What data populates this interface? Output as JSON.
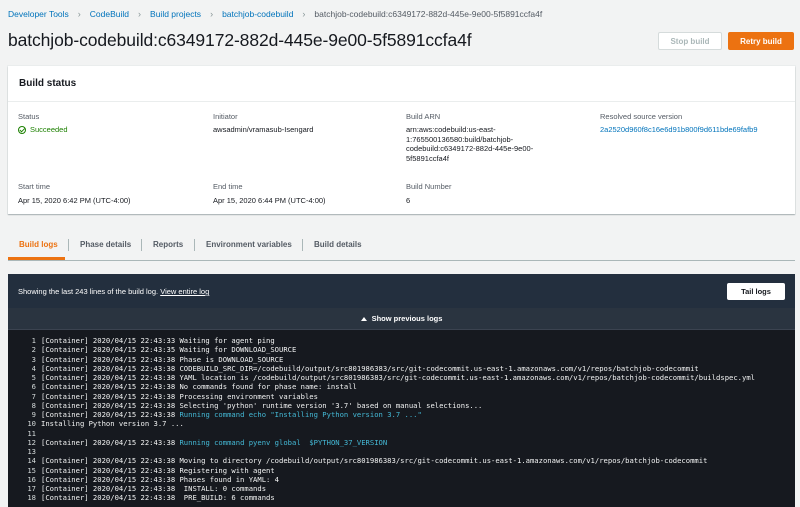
{
  "breadcrumb": {
    "items": [
      "Developer Tools",
      "CodeBuild",
      "Build projects",
      "batchjob-codebuild"
    ],
    "current": "batchjob-codebuild:c6349172-882d-445e-9e00-5f5891ccfa4f"
  },
  "page": {
    "title": "batchjob-codebuild:c6349172-882d-445e-9e00-5f5891ccfa4f",
    "stop_label": "Stop build",
    "retry_label": "Retry build"
  },
  "colors": {
    "accent": "#ec7211",
    "link": "#0073bb",
    "success": "#1d8102",
    "console_bg": "#16191f"
  },
  "build_status": {
    "title": "Build status",
    "status_label": "Status",
    "status_value": "Succeeded",
    "initiator_label": "Initiator",
    "initiator_value": "awsadmin/vramasub-Isengard",
    "arn_label": "Build ARN",
    "arn_lines": [
      "arn:aws:codebuild:us-east-",
      "1:765500136580:build/batchjob-",
      "codebuild:c6349172-882d-445e-9e00-",
      "5f5891ccfa4f"
    ],
    "source_label": "Resolved source version",
    "source_value": "2a2520d960f8c16e6d91b800f9d611bde69fafb9",
    "start_label": "Start time",
    "start_value": "Apr 15, 2020 6:42 PM (UTC-4:00)",
    "end_label": "End time",
    "end_value": "Apr 15, 2020 6:44 PM (UTC-4:00)",
    "number_label": "Build Number",
    "number_value": "6"
  },
  "tabs": [
    "Build logs",
    "Phase details",
    "Reports",
    "Environment variables",
    "Build details"
  ],
  "logs": {
    "summary": "Showing the last 243 lines of the build log.",
    "view_link": "View entire log",
    "tail_label": "Tail logs",
    "show_previous": "Show previous logs",
    "lines": [
      {
        "n": "1",
        "text": "[Container] 2020/04/15 22:43:33 Waiting for agent ping",
        "hl": ""
      },
      {
        "n": "2",
        "text": "[Container] 2020/04/15 22:43:35 Waiting for DOWNLOAD_SOURCE",
        "hl": ""
      },
      {
        "n": "3",
        "text": "[Container] 2020/04/15 22:43:38 Phase is DOWNLOAD_SOURCE",
        "hl": ""
      },
      {
        "n": "4",
        "text": "[Container] 2020/04/15 22:43:38 CODEBUILD_SRC_DIR=/codebuild/output/src801986383/src/git-codecommit.us-east-1.amazonaws.com/v1/repos/batchjob-codecommit",
        "hl": ""
      },
      {
        "n": "5",
        "text": "[Container] 2020/04/15 22:43:38 YAML location is /codebuild/output/src801986383/src/git-codecommit.us-east-1.amazonaws.com/v1/repos/batchjob-codecommit/buildspec.yml",
        "hl": ""
      },
      {
        "n": "6",
        "text": "[Container] 2020/04/15 22:43:38 No commands found for phase name: install",
        "hl": ""
      },
      {
        "n": "7",
        "text": "[Container] 2020/04/15 22:43:38 Processing environment variables",
        "hl": ""
      },
      {
        "n": "8",
        "text": "[Container] 2020/04/15 22:43:38 Selecting 'python' runtime version '3.7' based on manual selections...",
        "hl": ""
      },
      {
        "n": "9",
        "text": "[Container] 2020/04/15 22:43:38 ",
        "hl": "Running command echo \"Installing Python version 3.7 ...\""
      },
      {
        "n": "10",
        "text": "Installing Python version 3.7 ...",
        "hl": ""
      },
      {
        "n": "11",
        "text": "",
        "hl": ""
      },
      {
        "n": "12",
        "text": "[Container] 2020/04/15 22:43:38 ",
        "hl": "Running command pyenv global  $PYTHON_37_VERSION"
      },
      {
        "n": "13",
        "text": "",
        "hl": ""
      },
      {
        "n": "14",
        "text": "[Container] 2020/04/15 22:43:38 Moving to directory /codebuild/output/src801986383/src/git-codecommit.us-east-1.amazonaws.com/v1/repos/batchjob-codecommit",
        "hl": ""
      },
      {
        "n": "15",
        "text": "[Container] 2020/04/15 22:43:38 Registering with agent",
        "hl": ""
      },
      {
        "n": "16",
        "text": "[Container] 2020/04/15 22:43:38 Phases found in YAML: 4",
        "hl": ""
      },
      {
        "n": "17",
        "text": "[Container] 2020/04/15 22:43:38  INSTALL: 0 commands",
        "hl": ""
      },
      {
        "n": "18",
        "text": "[Container] 2020/04/15 22:43:38  PRE_BUILD: 6 commands",
        "hl": ""
      }
    ]
  }
}
